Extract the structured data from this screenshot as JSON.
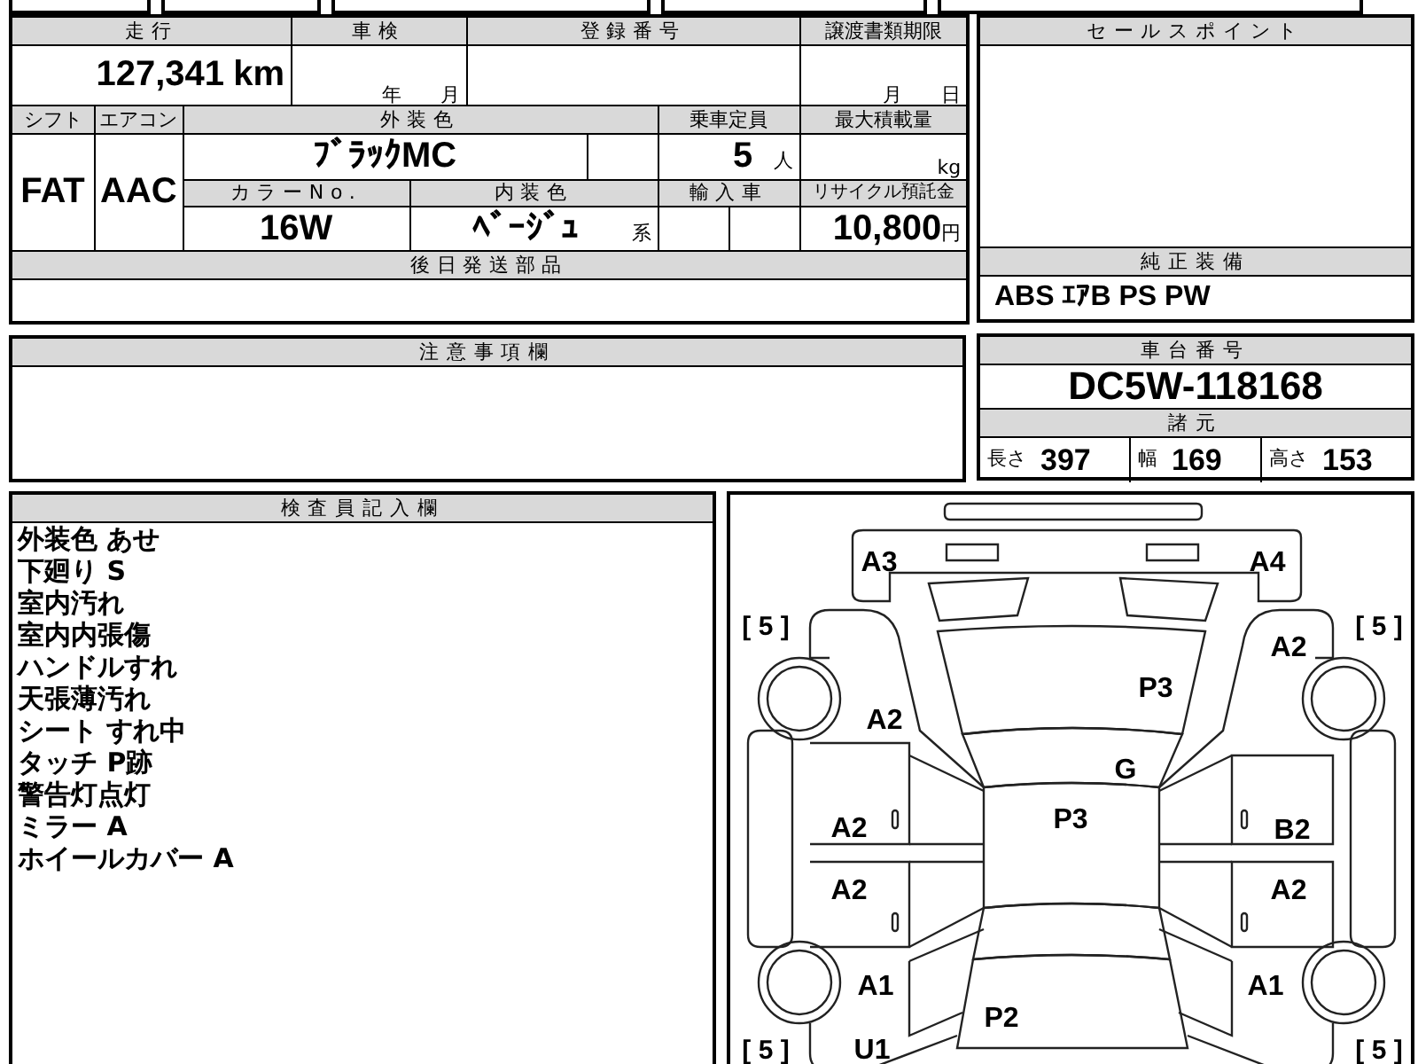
{
  "vehicle_form": {
    "mileage": {
      "label": "走行",
      "value": "127,341",
      "unit": "km"
    },
    "inspection": {
      "label": "車検",
      "year_unit": "年",
      "month_unit": "月"
    },
    "registration_number": {
      "label": "登録番号"
    },
    "transfer_deadline": {
      "label": "譲渡書類期限",
      "month_unit": "月",
      "day_unit": "日"
    },
    "shift": {
      "label": "シフト",
      "value": "FAT"
    },
    "air_conditioner": {
      "label": "エアコン",
      "value": "AAC"
    },
    "exterior_color": {
      "label": "外装色",
      "value": "ﾌﾞﾗｯｸMC"
    },
    "capacity": {
      "label": "乗車定員",
      "value": "5",
      "unit": "人"
    },
    "max_load": {
      "label": "最大積載量",
      "unit": "kg"
    },
    "color_number": {
      "label": "カラーNo.",
      "value": "16W"
    },
    "interior_color": {
      "label": "内装色",
      "value": "ﾍﾞｰｼﾞｭ",
      "suffix": "系"
    },
    "imported": {
      "label": "輸入車"
    },
    "recycling_deposit": {
      "label": "リサイクル預託金",
      "value": "10,800",
      "unit": "円"
    },
    "later_parts": {
      "label": "後日発送部品"
    }
  },
  "notes": {
    "label": "注意事項欄"
  },
  "sales_points": {
    "label": "セールスポイント"
  },
  "genuine_equipment": {
    "label": "純正装備",
    "value": "ABS ｴｱB PS PW"
  },
  "chassis_number": {
    "label": "車台番号",
    "value": "DC5W-118168"
  },
  "specs": {
    "label": "諸元",
    "items": [
      {
        "label": "長さ",
        "value": "397"
      },
      {
        "label": "幅",
        "value": "169"
      },
      {
        "label": "高さ",
        "value": "153"
      }
    ]
  },
  "inspector_notes": {
    "label": "検査員記入欄",
    "lines": [
      "外装色 あせ",
      "下廻り S",
      "室内汚れ",
      "室内内張傷",
      "ハンドルすれ",
      "天張薄汚れ",
      "シート すれ中",
      "タッチ P跡",
      "警告灯点灯",
      "ミラー A",
      "ホイールカバー A"
    ]
  },
  "damage_map": {
    "marks": [
      {
        "code": "A3"
      },
      {
        "code": "A4"
      },
      {
        "code": "A2"
      },
      {
        "code": "P3"
      },
      {
        "code": "A2"
      },
      {
        "code": "G"
      },
      {
        "code": "A2"
      },
      {
        "code": "P3"
      },
      {
        "code": "B2"
      },
      {
        "code": "A2"
      },
      {
        "code": "A2"
      },
      {
        "code": "A1"
      },
      {
        "code": "A1"
      },
      {
        "code": "P2"
      },
      {
        "code": "U1"
      }
    ],
    "tires": [
      {
        "text": "[ 5 ]"
      },
      {
        "text": "[ 5 ]"
      },
      {
        "text": "[ 5 ]"
      },
      {
        "text": "[ 5 ]"
      }
    ]
  }
}
